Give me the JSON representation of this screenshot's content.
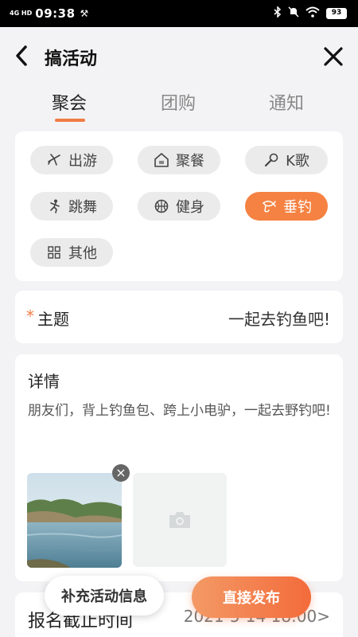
{
  "status_bar": {
    "network": "4G HD",
    "time": "09:38",
    "battery": "93"
  },
  "header": {
    "title": "搞活动",
    "back_icon": "chevron-left-icon",
    "close_icon": "close-icon"
  },
  "tabs": [
    {
      "label": "聚会",
      "active": true
    },
    {
      "label": "团购",
      "active": false
    },
    {
      "label": "通知",
      "active": false
    }
  ],
  "categories": [
    {
      "label": "出游",
      "icon": "airplane-icon",
      "selected": false
    },
    {
      "label": "聚餐",
      "icon": "restaurant-icon",
      "selected": false
    },
    {
      "label": "K歌",
      "icon": "microphone-icon",
      "selected": false
    },
    {
      "label": "跳舞",
      "icon": "dance-icon",
      "selected": false
    },
    {
      "label": "健身",
      "icon": "basketball-icon",
      "selected": false
    },
    {
      "label": "垂钓",
      "icon": "fishing-icon",
      "selected": true
    },
    {
      "label": "其他",
      "icon": "grid-icon",
      "selected": false
    }
  ],
  "topic": {
    "required_mark": "*",
    "label": "主题",
    "value": "一起去钓鱼吧!"
  },
  "details": {
    "label": "详情",
    "text": "朋友们，背上钓鱼包、跨上小电驴，一起去野钓吧!",
    "remove_photo": "×"
  },
  "deadline": {
    "label": "报名截止时间",
    "value": "2021-5-14 18:00>"
  },
  "actions": {
    "more_info": "补充活动信息",
    "publish": "直接发布"
  },
  "colors": {
    "accent": "#f58242",
    "tab_indicator": "#f07c45",
    "background": "#f3f3f5"
  }
}
